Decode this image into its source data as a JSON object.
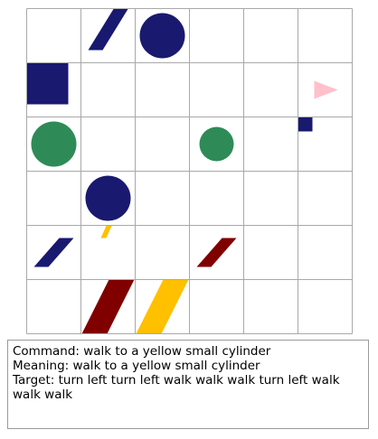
{
  "grid": {
    "rows": 6,
    "cols": 6,
    "line_color": "#a9a9a9",
    "background": "#ffffff",
    "objects": [
      {
        "shape": "cylinder",
        "color": "#191970",
        "size": "small",
        "row": 0,
        "col": 1
      },
      {
        "shape": "circle",
        "color": "#191970",
        "size": "small",
        "row": 0,
        "col": 2
      },
      {
        "shape": "square",
        "color": "#191970",
        "size": "small",
        "row": 1,
        "col": 0
      },
      {
        "shape": "triangle",
        "color": "#ffc0cb",
        "size": "small",
        "row": 1,
        "col": 5
      },
      {
        "shape": "circle",
        "color": "#2e8b57",
        "size": "small",
        "row": 2,
        "col": 0
      },
      {
        "shape": "circle",
        "color": "#2e8b57",
        "size": "tiny",
        "row": 2,
        "col": 3
      },
      {
        "shape": "square",
        "color": "#191970",
        "size": "tiny",
        "row": 2,
        "col": 5
      },
      {
        "shape": "circle",
        "color": "#191970",
        "size": "small",
        "row": 3,
        "col": 1
      },
      {
        "shape": "cylinder",
        "color": "#191970",
        "size": "small",
        "row": 4,
        "col": 0
      },
      {
        "shape": "cylinder",
        "color": "#ffc000",
        "size": "tiny",
        "row": 4,
        "col": 1
      },
      {
        "shape": "cylinder",
        "color": "#800000",
        "size": "small",
        "row": 4,
        "col": 3
      },
      {
        "shape": "cylinder",
        "color": "#800000",
        "size": "big",
        "row": 5,
        "col": 1
      },
      {
        "shape": "cylinder",
        "color": "#ffc000",
        "size": "big",
        "row": 5,
        "col": 2
      }
    ]
  },
  "panel": {
    "command_line": "Command: walk to a yellow small cylinder",
    "meaning_line": "Meaning:  walk to a yellow small cylinder",
    "target_line": "Target: turn left turn left walk walk walk turn left walk walk walk"
  }
}
